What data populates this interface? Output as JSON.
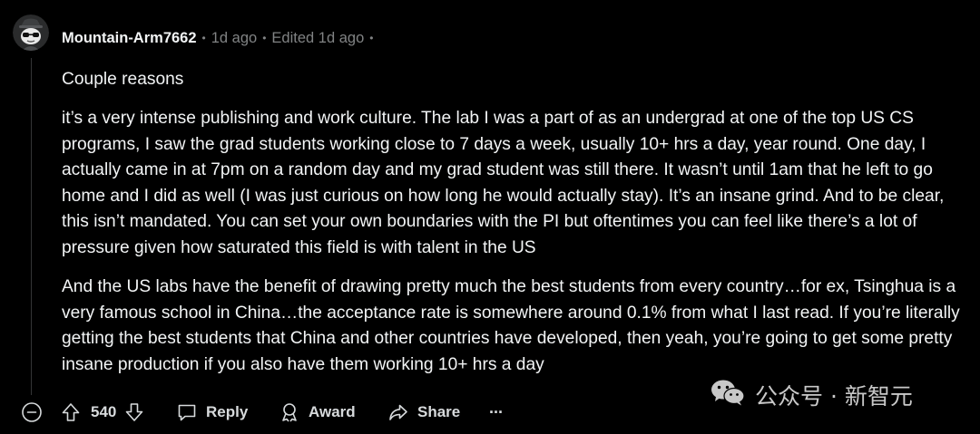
{
  "comment": {
    "username": "Mountain-Arm7662",
    "separator": "•",
    "posted": "1d ago",
    "edited": "Edited 1d ago",
    "paragraphs": [
      "Couple reasons",
      "it’s a very intense publishing and work culture. The lab I was a part of as an undergrad at one of the top US CS programs, I saw the grad students working close to 7 days a week, usually 10+ hrs a day, year round. One day, I actually came in at 7pm on a random day and my grad student was still there. It wasn’t until 1am that he left to go home and I did as well (I was just curious on how long he would actually stay). It’s an insane grind. And to be clear, this isn’t mandated. You can set your own boundaries with the PI but oftentimes you can feel like there’s a lot of pressure given how saturated this field is with talent in the US",
      "And the US labs have the benefit of drawing pretty much the best students from every country…for ex, Tsinghua is a very famous school in China…the acceptance rate is somewhere around 0.1% from what I last read. If you’re literally getting the best students that China and other countries have developed, then yeah, you’re going to get some pretty insane production if you also have them working 10+ hrs a day"
    ]
  },
  "actions": {
    "vote_count": "540",
    "reply_label": "Reply",
    "award_label": "Award",
    "share_label": "Share",
    "more_label": "···"
  },
  "watermark": {
    "text": "公众号 · 新智元"
  },
  "icons": {
    "avatar": "snoo-avatar",
    "collapse": "collapse-minus-icon",
    "upvote": "upvote-arrow-icon",
    "downvote": "downvote-arrow-icon",
    "reply": "speech-bubble-icon",
    "award": "award-ribbon-icon",
    "share": "share-arrow-icon",
    "watermark": "wechat-icon"
  },
  "colors": {
    "background": "#000000",
    "text": "#f2f4f5",
    "meta": "#818384",
    "thread_line": "#343536"
  }
}
